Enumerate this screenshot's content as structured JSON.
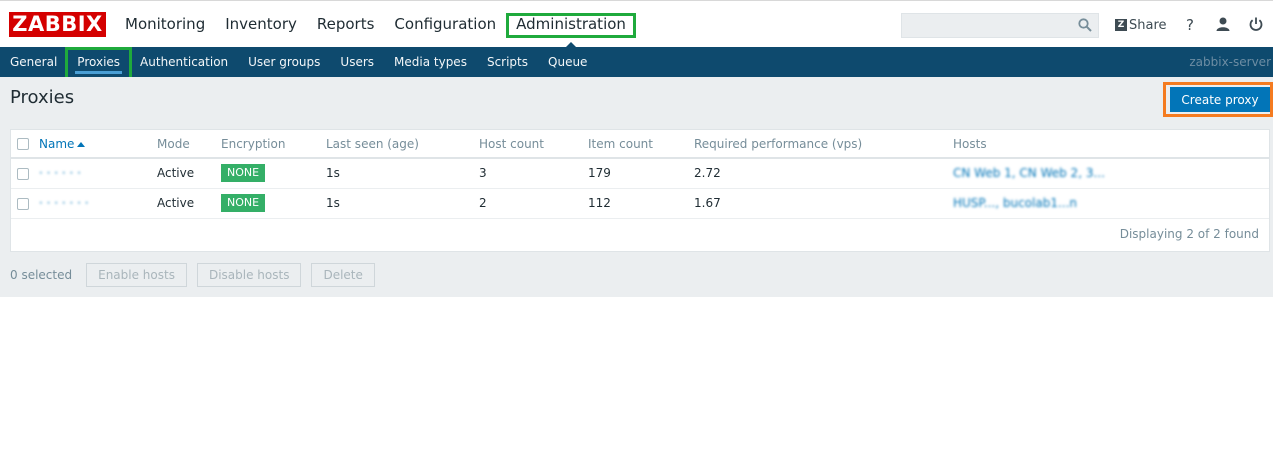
{
  "app": {
    "logo_text": "ZABBIX"
  },
  "main_nav": {
    "items": [
      {
        "label": "Monitoring"
      },
      {
        "label": "Inventory"
      },
      {
        "label": "Reports"
      },
      {
        "label": "Configuration"
      },
      {
        "label": "Administration",
        "active": true
      }
    ]
  },
  "header": {
    "search_placeholder": "",
    "share_label": "Share",
    "icons": [
      "search-icon",
      "help-icon",
      "user-icon",
      "power-icon"
    ]
  },
  "sub_nav": {
    "items": [
      {
        "label": "General"
      },
      {
        "label": "Proxies",
        "active": true
      },
      {
        "label": "Authentication"
      },
      {
        "label": "User groups"
      },
      {
        "label": "Users"
      },
      {
        "label": "Media types"
      },
      {
        "label": "Scripts"
      },
      {
        "label": "Queue"
      }
    ],
    "server_name": "zabbix-server"
  },
  "page": {
    "title": "Proxies",
    "create_button": "Create proxy"
  },
  "table": {
    "columns": [
      "Name",
      "Mode",
      "Encryption",
      "Last seen (age)",
      "Host count",
      "Item count",
      "Required performance (vps)",
      "Hosts"
    ],
    "rows": [
      {
        "name": "· · ·  · · ·",
        "mode": "Active",
        "encryption": "NONE",
        "last_seen": "1s",
        "host_count": "3",
        "item_count": "179",
        "required_performance": "2.72",
        "hosts": "CN Web 1, CN Web 2, 3..."
      },
      {
        "name": "· · · · ·  · ·",
        "mode": "Active",
        "encryption": "NONE",
        "last_seen": "1s",
        "host_count": "2",
        "item_count": "112",
        "required_performance": "1.67",
        "hosts": "HUSP..., bucolab1...n"
      }
    ],
    "footer": "Displaying 2 of 2 found"
  },
  "actions": {
    "selected": "0 selected",
    "buttons": [
      "Enable hosts",
      "Disable hosts",
      "Delete"
    ]
  },
  "colors": {
    "logo": "#d40000",
    "subnav_bg": "#0e4a6e",
    "primary": "#0275b8",
    "highlight_green": "#1faa3c",
    "highlight_orange": "#f47b20",
    "badge_green": "#34af67",
    "content_bg": "#ebeef0"
  }
}
